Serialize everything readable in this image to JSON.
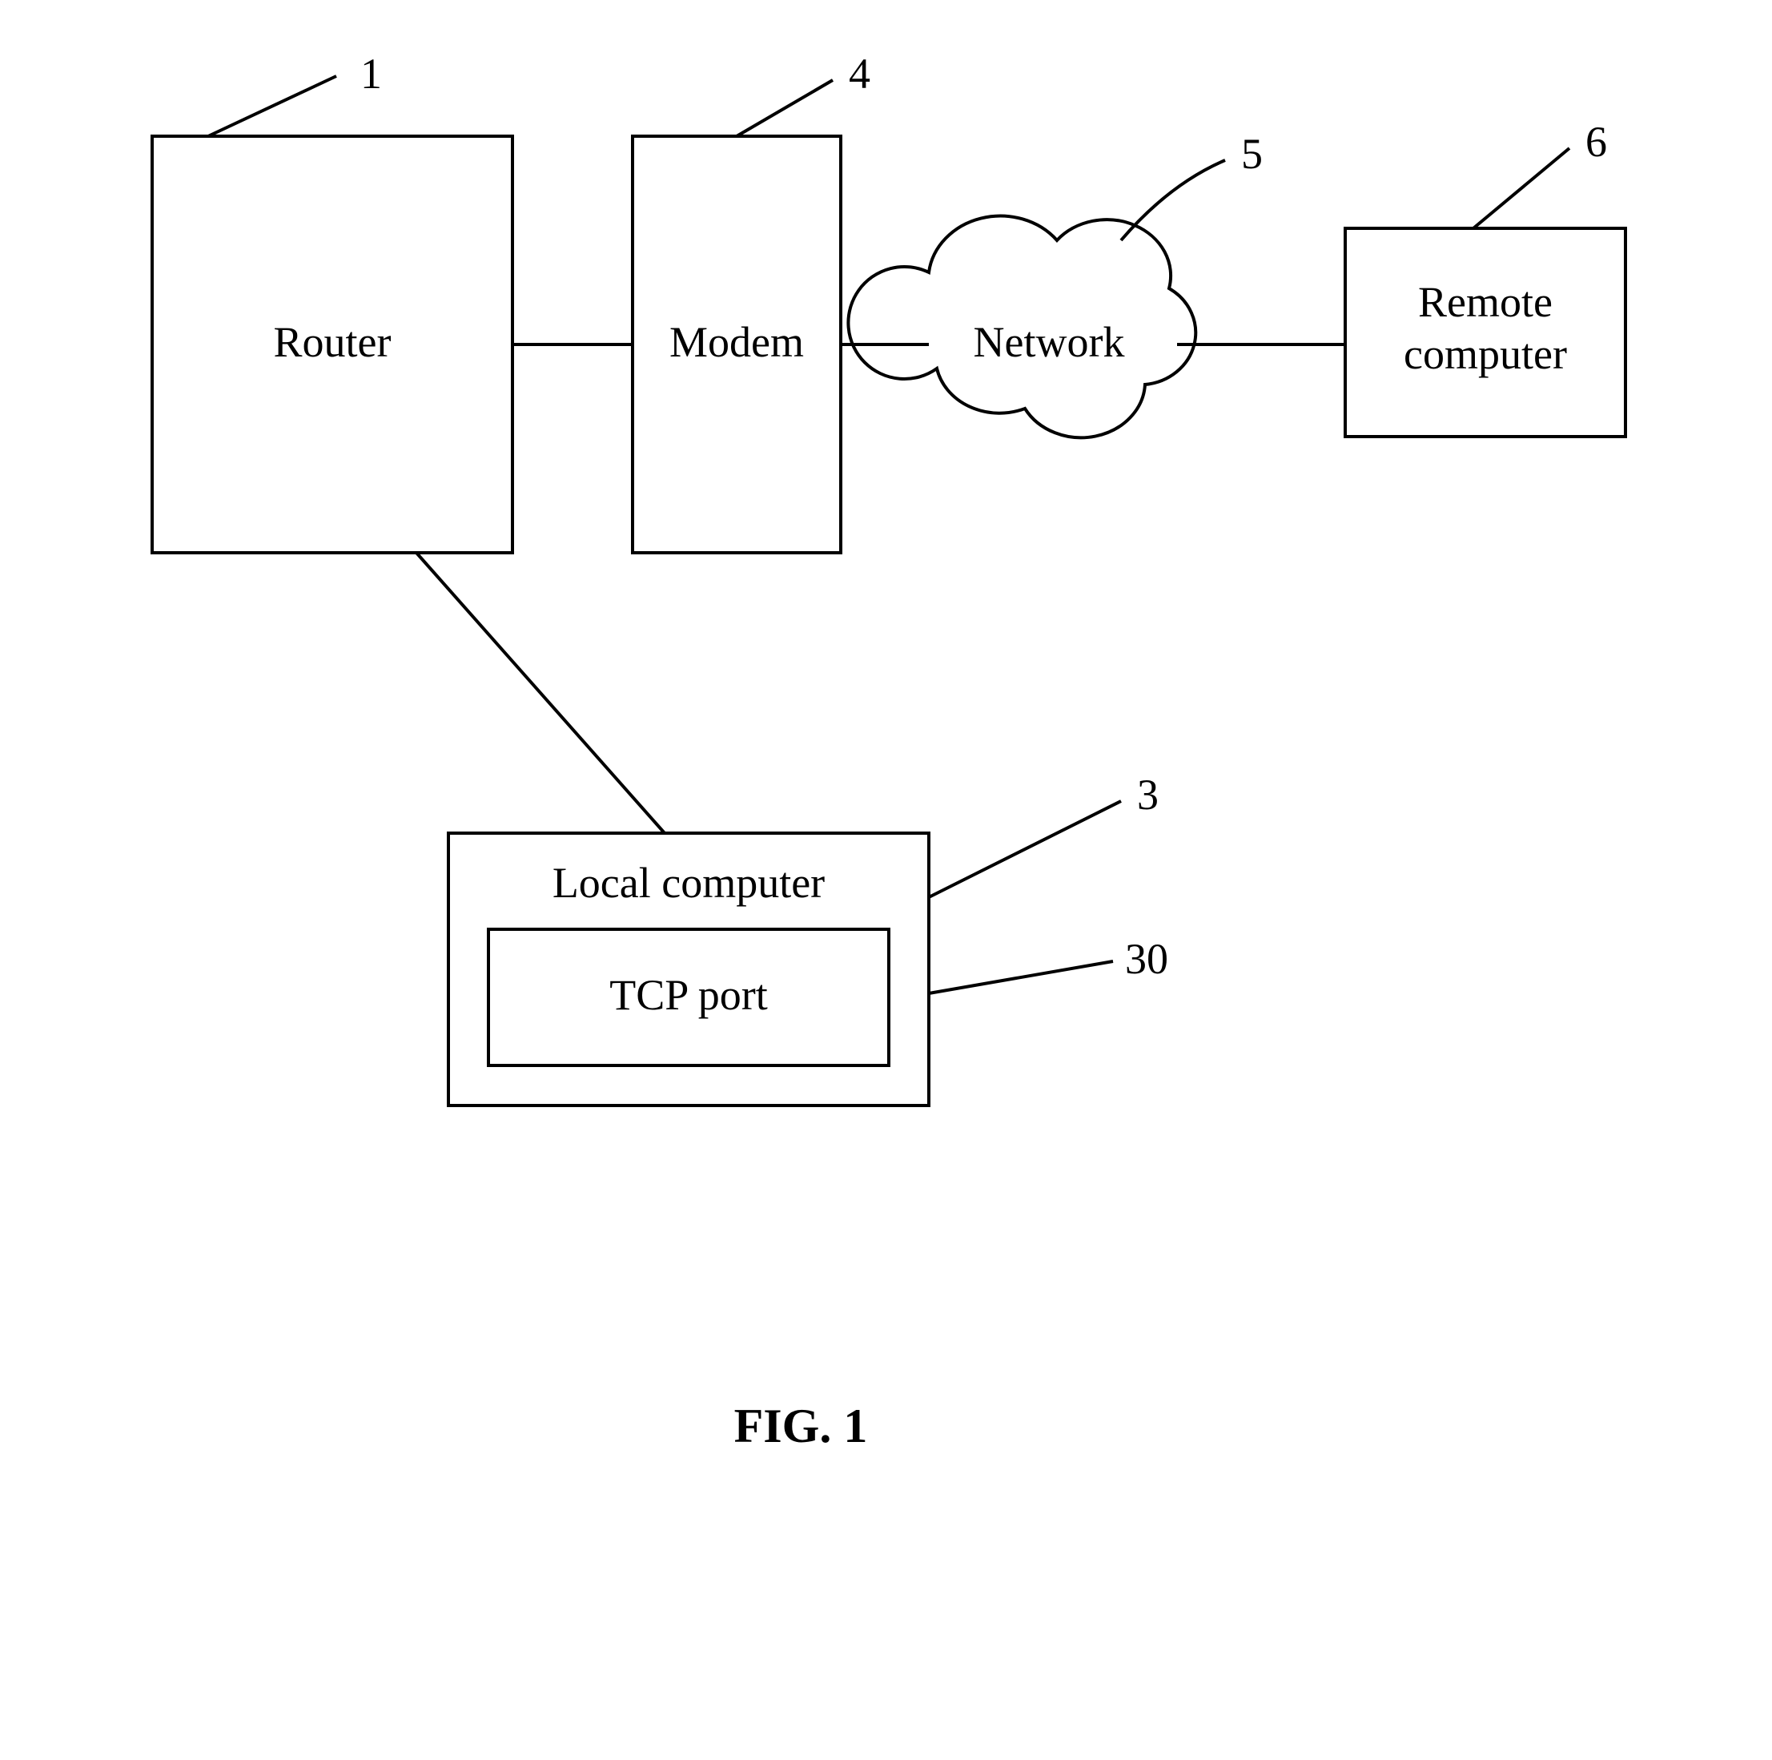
{
  "figure": {
    "caption": "FIG. 1",
    "nodes": {
      "router": {
        "label": "Router",
        "ref": "1"
      },
      "modem": {
        "label": "Modem",
        "ref": "4"
      },
      "network": {
        "label": "Network",
        "ref": "5"
      },
      "remote": {
        "label": "Remote computer",
        "ref": "6"
      },
      "local": {
        "label": "Local computer",
        "ref": "3"
      },
      "tcpport": {
        "label": "TCP port",
        "ref": "30"
      }
    }
  }
}
